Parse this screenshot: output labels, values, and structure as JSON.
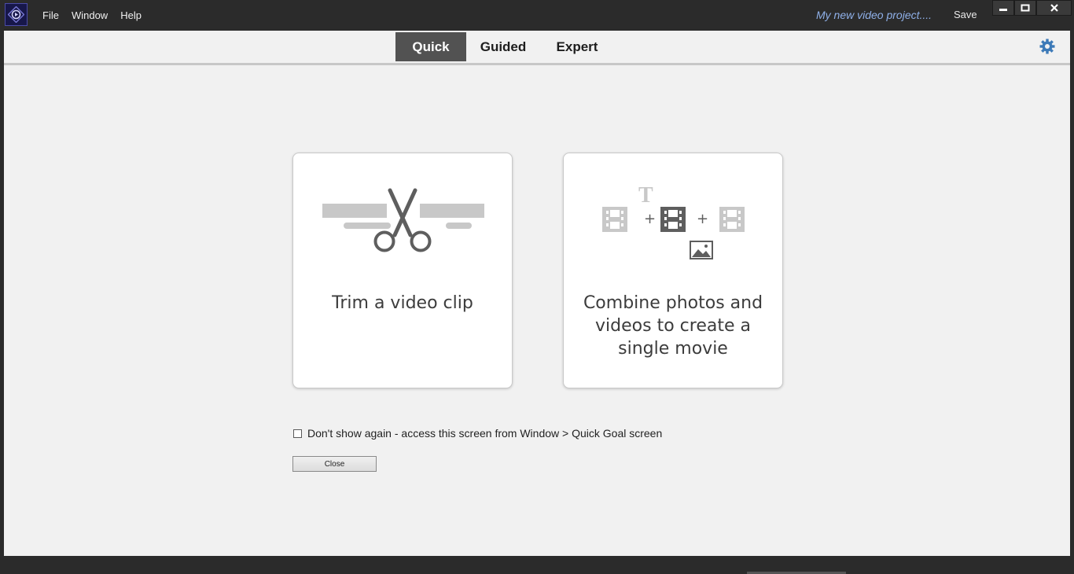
{
  "titlebar": {
    "menu": [
      "File",
      "Window",
      "Help"
    ],
    "project_name": "My new video project....",
    "save_label": "Save"
  },
  "tabs": [
    {
      "label": "Quick",
      "active": true
    },
    {
      "label": "Guided",
      "active": false
    },
    {
      "label": "Expert",
      "active": false
    }
  ],
  "cards": [
    {
      "label": "Trim a video clip",
      "icon": "scissors-trim-icon"
    },
    {
      "label_lines": [
        "Combine photos and",
        "videos to create a",
        "single movie"
      ],
      "icon": "combine-media-icon"
    }
  ],
  "dont_show": {
    "label": "Don't show again - access this screen from Window > Quick Goal screen",
    "checked": false
  },
  "close_label": "Close",
  "colors": {
    "chrome": "#2b2b2b",
    "panel": "#f1f1f1",
    "active_tab": "#525252",
    "settings_accent": "#3d7ab8",
    "icon_dark": "#5e5e5e",
    "icon_light": "#c8c8c8"
  }
}
